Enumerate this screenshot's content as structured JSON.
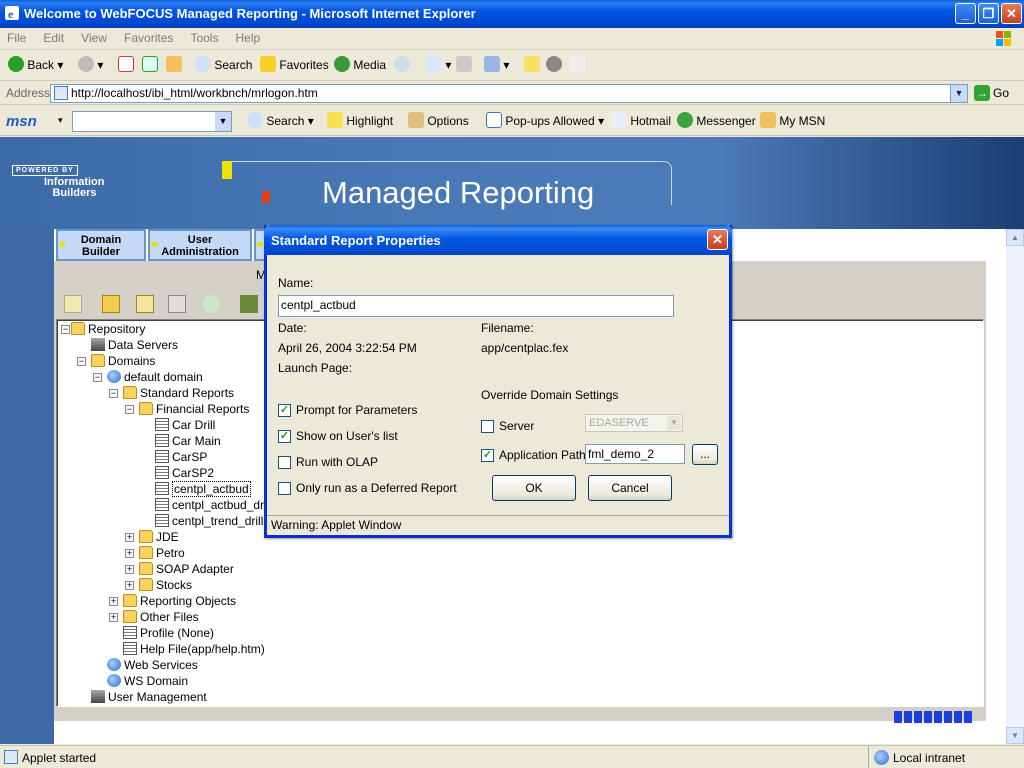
{
  "window": {
    "title": "Welcome to WebFOCUS Managed Reporting - Microsoft Internet Explorer",
    "minimize": "_",
    "restore": "❐",
    "close": "✕"
  },
  "menu": [
    "File",
    "Edit",
    "View",
    "Favorites",
    "Tools",
    "Help"
  ],
  "toolbar": {
    "back": "Back",
    "search": "Search",
    "favorites": "Favorites",
    "media": "Media"
  },
  "address": {
    "label": "Address",
    "url": "http://localhost/ibi_html/workbnch/mrlogon.htm",
    "go": "Go"
  },
  "msnbar": {
    "logo": "msn",
    "search": "Search",
    "highlight": "Highlight",
    "options": "Options",
    "popups": "Pop-ups Allowed",
    "hotmail": "Hotmail",
    "messenger": "Messenger",
    "mymsn": "My MSN"
  },
  "banner": {
    "title": "Managed Reporting",
    "powered": "POWERED BY",
    "brand_line1": "Information",
    "brand_line2": "Builders"
  },
  "tabs": {
    "domain_builder_l1": "Domain",
    "domain_builder_l2": "Builder",
    "user_admin_l1": "User",
    "user_admin_l2": "Administration",
    "partial": "M"
  },
  "tree": {
    "repository": "Repository",
    "data_servers": "Data Servers",
    "domains": "Domains",
    "default_domain": "default domain",
    "standard_reports": "Standard Reports",
    "financial_reports": "Financial Reports",
    "car_drill": "Car Drill",
    "car_main": "Car Main",
    "carsp": "CarSP",
    "carsp2": "CarSP2",
    "centpl_actbud": "centpl_actbud",
    "centpl_actbud_drill": "centpl_actbud_drill",
    "centpl_trend_drill": "centpl_trend_drill",
    "jde": "JDE",
    "petro": "Petro",
    "soap_adapter": "SOAP Adapter",
    "stocks": "Stocks",
    "reporting_objects": "Reporting Objects",
    "other_files": "Other Files",
    "profile": "Profile (None)",
    "help_file": "Help File(app/help.htm)",
    "web_services": "Web Services",
    "ws_domain": "WS Domain",
    "user_management": "User Management"
  },
  "dialog": {
    "title": "Standard Report Properties",
    "name_label": "Name:",
    "name_value": "centpl_actbud",
    "date_label": "Date:",
    "date_value": "April 26, 2004 3:22:54 PM",
    "filename_label": "Filename:",
    "filename_value": "app/centplac.fex",
    "launch_label": "Launch Page:",
    "override_label": "Override Domain Settings",
    "prompt_label": "Prompt for Parameters",
    "prompt_checked": true,
    "show_label": "Show on User's list",
    "show_checked": true,
    "olap_label": "Run with OLAP",
    "olap_checked": false,
    "deferred_label": "Only run as a Deferred Report",
    "deferred_checked": false,
    "server_label": "Server",
    "server_checked": false,
    "server_value": "EDASERVE",
    "apppath_label": "Application Path",
    "apppath_checked": true,
    "apppath_value": "fml_demo_2",
    "browse": "...",
    "ok": "OK",
    "cancel": "Cancel",
    "warning": "Warning: Applet Window",
    "check_mark": "✓"
  },
  "status": {
    "left": "Applet started",
    "zone": "Local intranet"
  }
}
